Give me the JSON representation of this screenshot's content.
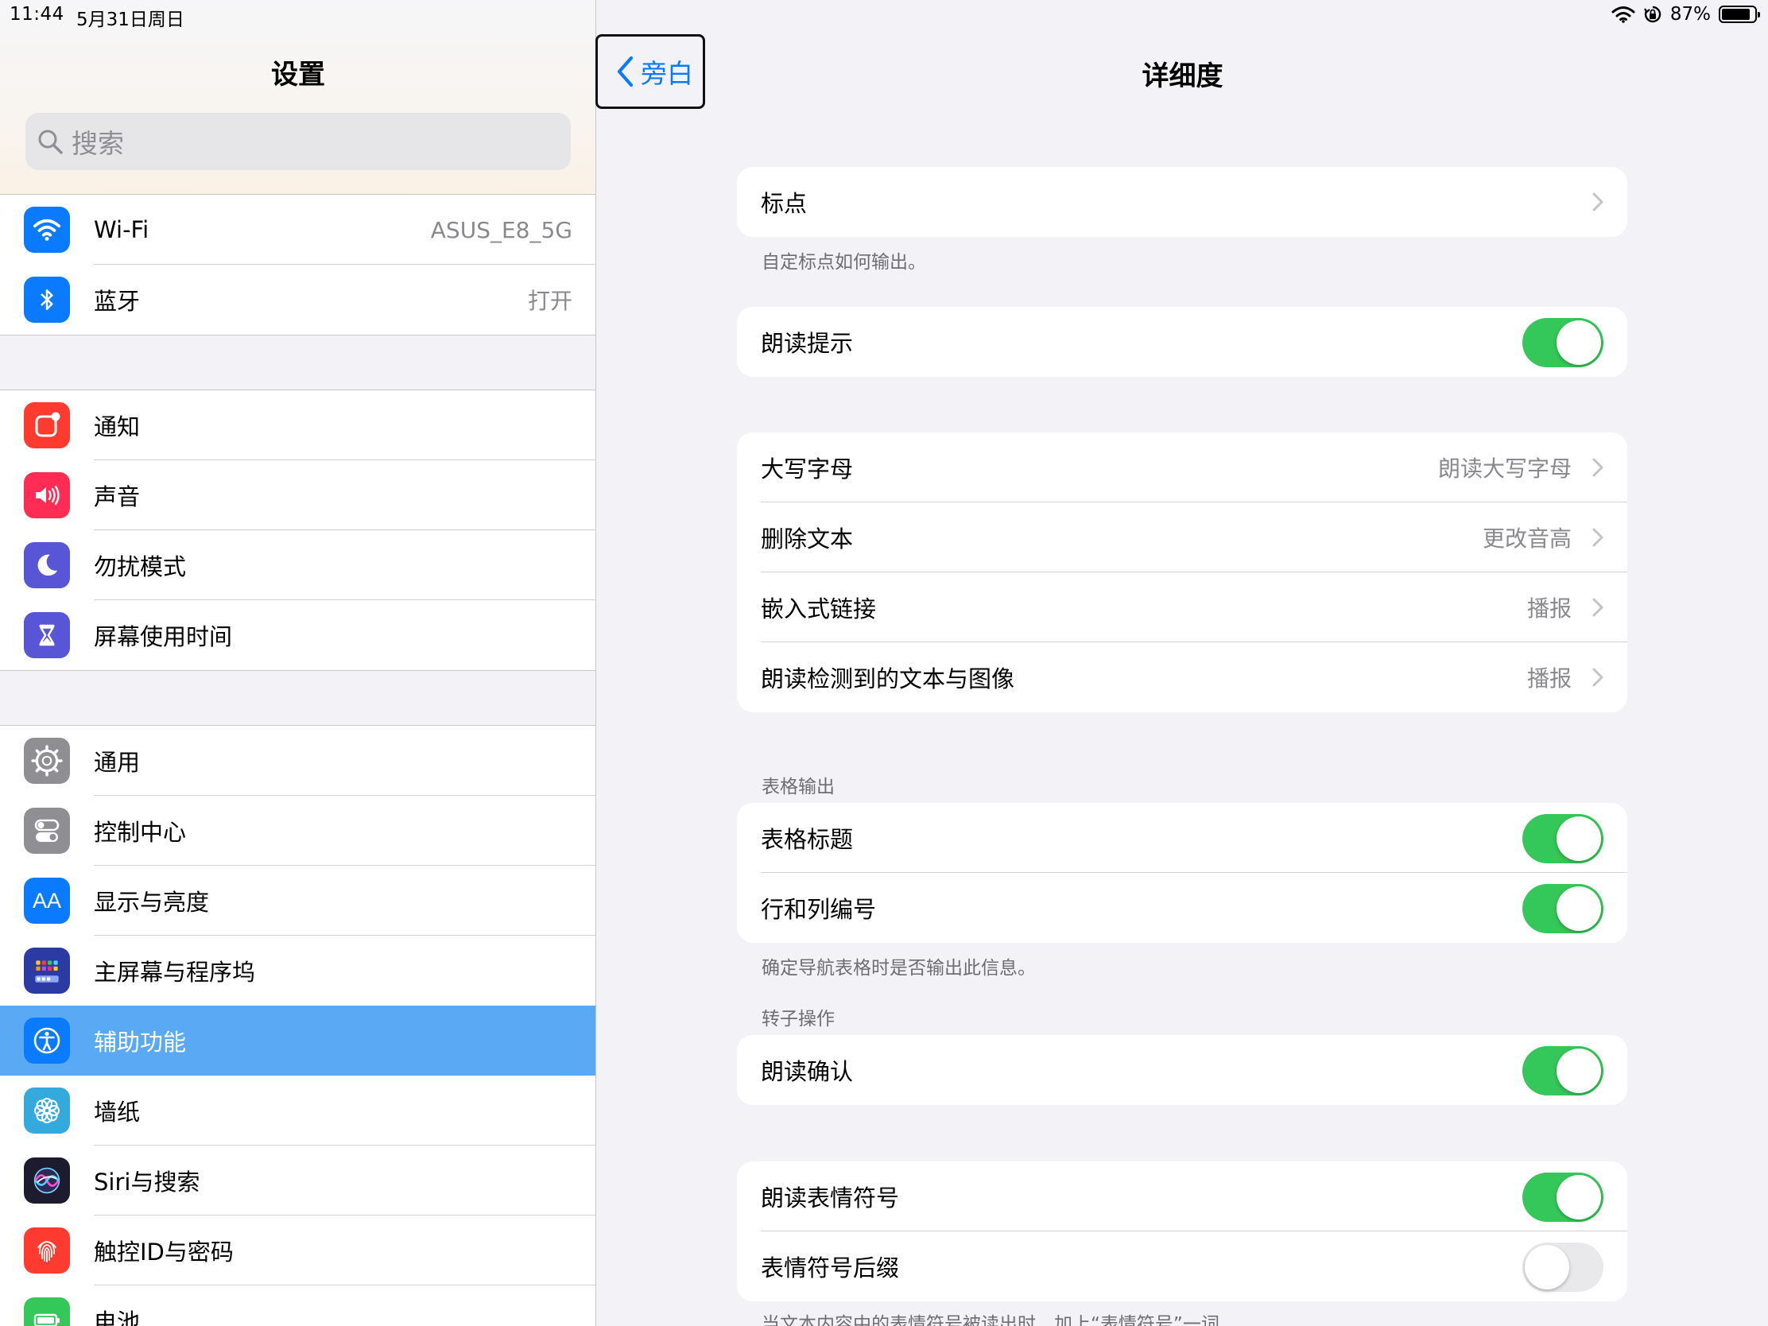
{
  "status": {
    "time": "11:44",
    "date": "5月31日周日",
    "battery": "87%",
    "battery_level": 0.87
  },
  "sidebar": {
    "title": "设置",
    "search_placeholder": "搜索",
    "items": [
      {
        "label": "Wi-Fi",
        "value": "ASUS_E8_5G",
        "icon": "wifi-icon",
        "color": "#0a7aff"
      },
      {
        "label": "蓝牙",
        "value": "打开",
        "icon": "bluetooth-icon",
        "color": "#0a7aff"
      },
      {
        "label": "通知",
        "icon": "notifications-icon",
        "color": "#ff3b30"
      },
      {
        "label": "声音",
        "icon": "sound-icon",
        "color": "#ff2d55"
      },
      {
        "label": "勿扰模式",
        "icon": "moon-icon",
        "color": "#5856d6"
      },
      {
        "label": "屏幕使用时间",
        "icon": "hourglass-icon",
        "color": "#5856d6"
      },
      {
        "label": "通用",
        "icon": "gear-icon",
        "color": "#8e8e93"
      },
      {
        "label": "控制中心",
        "icon": "control-center-icon",
        "color": "#8e8e93"
      },
      {
        "label": "显示与亮度",
        "icon": "display-icon",
        "color": "#0a7aff"
      },
      {
        "label": "主屏幕与程序坞",
        "icon": "home-screen-icon",
        "color": "#2c3aa3"
      },
      {
        "label": "辅助功能",
        "icon": "accessibility-icon",
        "color": "#0a7aff"
      },
      {
        "label": "墙纸",
        "icon": "wallpaper-icon",
        "color": "#34aadc"
      },
      {
        "label": "Siri与搜索",
        "icon": "siri-icon",
        "color": "#222233"
      },
      {
        "label": "触控ID与密码",
        "icon": "fingerprint-icon",
        "color": "#ff3b30"
      },
      {
        "label": "电池",
        "icon": "battery-icon",
        "color": "#34c759"
      }
    ]
  },
  "detail": {
    "back_label": "旁白",
    "title": "详细度",
    "punctuation": {
      "label": "标点",
      "footnote": "自定标点如何输出。"
    },
    "read_hints": {
      "label": "朗读提示",
      "on": true
    },
    "speech_rows": [
      {
        "label": "大写字母",
        "value": "朗读大写字母"
      },
      {
        "label": "删除文本",
        "value": "更改音高"
      },
      {
        "label": "嵌入式链接",
        "value": "播报"
      },
      {
        "label": "朗读检测到的文本与图像",
        "value": "播报"
      }
    ],
    "table_section": {
      "header": "表格输出",
      "rows": [
        {
          "label": "表格标题",
          "on": true
        },
        {
          "label": "行和列编号",
          "on": true
        }
      ],
      "footnote": "确定导航表格时是否输出此信息。"
    },
    "rotor_section": {
      "header": "转子操作",
      "rows": [
        {
          "label": "朗读确认",
          "on": true
        }
      ]
    },
    "emoji_rows": [
      {
        "label": "朗读表情符号",
        "on": true
      },
      {
        "label": "表情符号后缀",
        "on": false
      }
    ],
    "emoji_footnote": "当文本内容中的表情符号被读出时，加上“表情符号”一词"
  }
}
